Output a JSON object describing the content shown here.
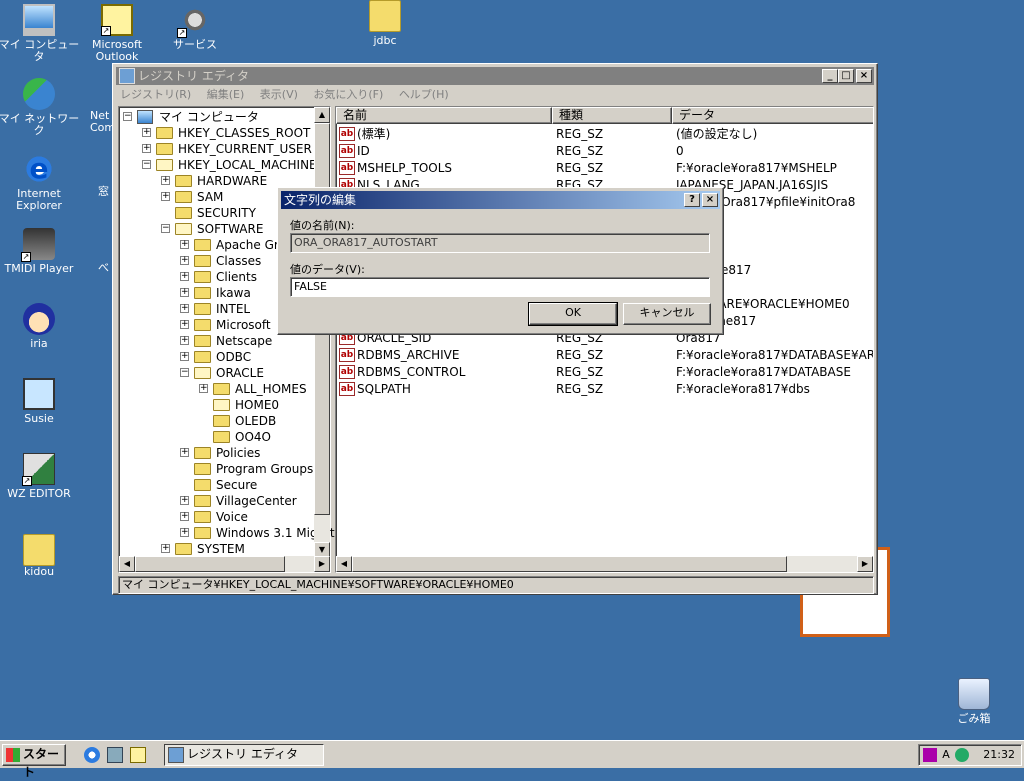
{
  "desktop": {
    "icons": [
      {
        "label": "マイ コンピュータ",
        "icon": "my-computer-icon"
      },
      {
        "label": "Microsoft Outlook",
        "icon": "outlook-icon"
      },
      {
        "label": "サービス",
        "icon": "services-icon"
      },
      {
        "label": "jdbc",
        "icon": "folder-icon"
      },
      {
        "label": "マイ ネットワーク",
        "icon": "network-icon"
      },
      {
        "label": "Internet Explorer",
        "icon": "internet-explorer-icon"
      },
      {
        "label": "TMIDI Player",
        "icon": "midi-player-icon"
      },
      {
        "label": "iria",
        "icon": "iria-icon"
      },
      {
        "label": "Susie",
        "icon": "susie-icon"
      },
      {
        "label": "WZ EDITOR",
        "icon": "wz-editor-icon"
      },
      {
        "label": "kidou",
        "icon": "folder-icon"
      },
      {
        "label": "ごみ箱",
        "icon": "recycle-bin-icon"
      }
    ],
    "partial_labels": [
      "Net",
      "Comm",
      "窓",
      "べ"
    ]
  },
  "registry_window": {
    "title": "レジストリ エディタ",
    "menu": [
      "レジストリ(R)",
      "編集(E)",
      "表示(V)",
      "お気に入り(F)",
      "ヘルプ(H)"
    ],
    "tree": [
      {
        "label": "マイ コンピュータ",
        "expander": "−"
      },
      {
        "label": "HKEY_CLASSES_ROOT",
        "expander": "+"
      },
      {
        "label": "HKEY_CURRENT_USER",
        "expander": "+"
      },
      {
        "label": "HKEY_LOCAL_MACHINE",
        "expander": "−"
      },
      {
        "label": "HARDWARE",
        "expander": "+"
      },
      {
        "label": "SAM",
        "expander": "+"
      },
      {
        "label": "SECURITY",
        "expander": ""
      },
      {
        "label": "SOFTWARE",
        "expander": "−"
      },
      {
        "label": "Apache Grou",
        "expander": "+"
      },
      {
        "label": "Classes",
        "expander": "+"
      },
      {
        "label": "Clients",
        "expander": "+"
      },
      {
        "label": "Ikawa",
        "expander": "+"
      },
      {
        "label": "INTEL",
        "expander": "+"
      },
      {
        "label": "Microsoft",
        "expander": "+"
      },
      {
        "label": "Netscape",
        "expander": "+"
      },
      {
        "label": "ODBC",
        "expander": "+"
      },
      {
        "label": "ORACLE",
        "expander": "−"
      },
      {
        "label": "ALL_HOMES",
        "expander": "+"
      },
      {
        "label": "HOME0",
        "expander": ""
      },
      {
        "label": "OLEDB",
        "expander": ""
      },
      {
        "label": "OO4O",
        "expander": ""
      },
      {
        "label": "Policies",
        "expander": "+"
      },
      {
        "label": "Program Groups",
        "expander": ""
      },
      {
        "label": "Secure",
        "expander": ""
      },
      {
        "label": "VillageCenter",
        "expander": "+"
      },
      {
        "label": "Voice",
        "expander": "+"
      },
      {
        "label": "Windows 3.1 Migrat",
        "expander": "+"
      },
      {
        "label": "SYSTEM",
        "expander": "+"
      }
    ],
    "list": {
      "columns": [
        "名前",
        "種類",
        "データ"
      ],
      "rows": [
        {
          "name": "(標準)",
          "type": "REG_SZ",
          "data": "(値の設定なし)"
        },
        {
          "name": "ID",
          "type": "REG_SZ",
          "data": "0"
        },
        {
          "name": "MSHELP_TOOLS",
          "type": "REG_SZ",
          "data": "F:¥oracle¥ora817¥MSHELP"
        },
        {
          "name": "NLS_LANG",
          "type": "REG_SZ",
          "data": "JAPANESE_JAPAN.JA16SJIS"
        },
        {
          "name": "",
          "type": "",
          "data": "admin¥Ora817¥pfile¥initOra8"
        },
        {
          "name": "",
          "type": "",
          "data": ""
        },
        {
          "name": "",
          "type": "",
          "data": ""
        },
        {
          "name": "",
          "type": "",
          "data": ""
        },
        {
          "name": "",
          "type": "",
          "data": ")raHome817"
        },
        {
          "name": "",
          "type": "",
          "data": "ora817"
        },
        {
          "name": "ORACLE_HOME_KEY",
          "type": "REG_SZ",
          "data": "SOFTWARE¥ORACLE¥HOME0"
        },
        {
          "name": "ORACLE_HOME_NAME",
          "type": "REG_SZ",
          "data": "OraHome817"
        },
        {
          "name": "ORACLE_SID",
          "type": "REG_SZ",
          "data": "Ora817"
        },
        {
          "name": "RDBMS_ARCHIVE",
          "type": "REG_SZ",
          "data": "F:¥oracle¥ora817¥DATABASE¥ARCHIV"
        },
        {
          "name": "RDBMS_CONTROL",
          "type": "REG_SZ",
          "data": "F:¥oracle¥ora817¥DATABASE"
        },
        {
          "name": "SQLPATH",
          "type": "REG_SZ",
          "data": "F:¥oracle¥ora817¥dbs"
        }
      ]
    },
    "status": "マイ コンピュータ¥HKEY_LOCAL_MACHINE¥SOFTWARE¥ORACLE¥HOME0"
  },
  "dialog": {
    "title": "文字列の編集",
    "help_btn": "?",
    "close_btn": "×",
    "name_label": "値の名前(N):",
    "name_value": "ORA_ORA817_AUTOSTART",
    "data_label": "値のデータ(V):",
    "data_value": "FALSE",
    "ok": "OK",
    "cancel": "キャンセル"
  },
  "taskbar": {
    "start": "スタート",
    "task": "レジストリ エディタ",
    "clock": "21:32",
    "ime": "A"
  },
  "colors": {
    "desktop": "#3a6ea5",
    "active_title": "#0a246a",
    "inactive_title": "#808080"
  }
}
